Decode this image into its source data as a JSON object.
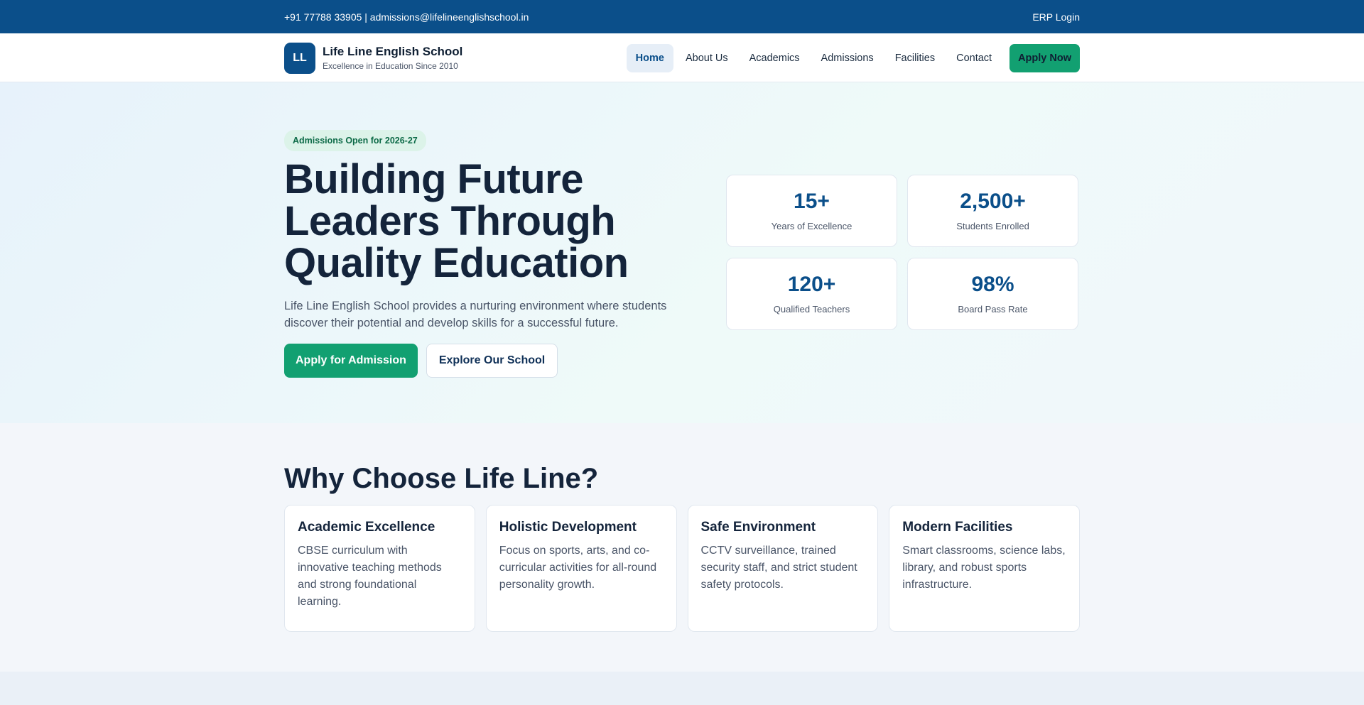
{
  "topbar": {
    "contact": "+91 77788 33905 | admissions@lifelineenglishschool.in",
    "erp_login": "ERP Login"
  },
  "header": {
    "logo_text": "LL",
    "school_name": "Life Line English School",
    "tagline": "Excellence in Education Since 2010",
    "nav": [
      {
        "label": "Home",
        "active": true
      },
      {
        "label": "About Us",
        "active": false
      },
      {
        "label": "Academics",
        "active": false
      },
      {
        "label": "Admissions",
        "active": false
      },
      {
        "label": "Facilities",
        "active": false
      },
      {
        "label": "Contact",
        "active": false
      }
    ],
    "cta": "Apply Now"
  },
  "hero": {
    "badge": "Admissions Open for 2026-27",
    "title": "Building Future Leaders Through Quality Education",
    "description": "Life Line English School provides a nurturing environment where students discover their potential and develop skills for a successful future.",
    "primary_button": "Apply for Admission",
    "secondary_button": "Explore Our School",
    "stats": [
      {
        "value": "15+",
        "label": "Years of Excellence"
      },
      {
        "value": "2,500+",
        "label": "Students Enrolled"
      },
      {
        "value": "120+",
        "label": "Qualified Teachers"
      },
      {
        "value": "98%",
        "label": "Board Pass Rate"
      }
    ]
  },
  "features": {
    "title": "Why Choose Life Line?",
    "cards": [
      {
        "title": "Academic Excellence",
        "description": "CBSE curriculum with innovative teaching methods and strong foundational learning."
      },
      {
        "title": "Holistic Development",
        "description": "Focus on sports, arts, and co-curricular activities for all-round personality growth."
      },
      {
        "title": "Safe Environment",
        "description": "CCTV surveillance, trained security staff, and strict student safety protocols."
      },
      {
        "title": "Modern Facilities",
        "description": "Smart classrooms, science labs, library, and robust sports infrastructure."
      }
    ]
  },
  "colors": {
    "primary_blue": "#0b4f8a",
    "accent_green": "#12a071",
    "heading": "#14243b"
  }
}
